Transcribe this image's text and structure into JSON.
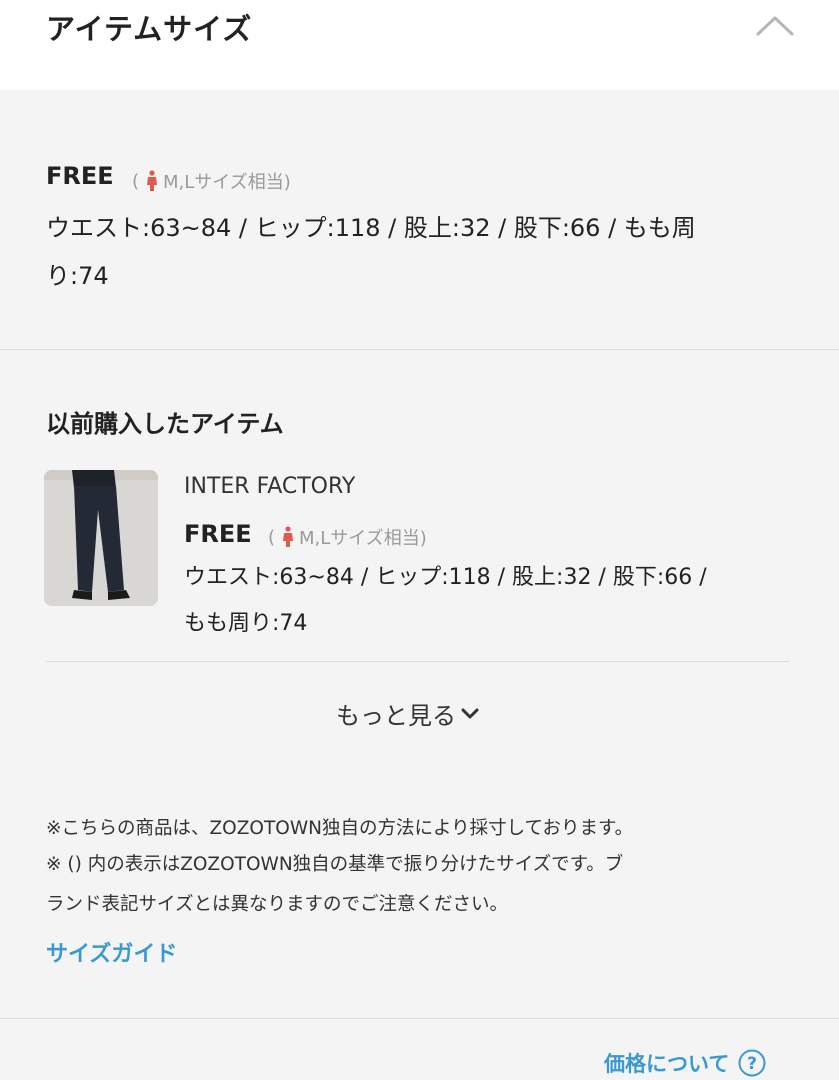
{
  "header": {
    "title": "アイテムサイズ",
    "collapse_icon": "chevron-up-icon"
  },
  "current_size": {
    "label": "FREE",
    "note_open": "(",
    "note_icon": "person-icon",
    "note_text": "M,Lサイズ相当)",
    "measurements_line1": "ウエスト:63~84 / ヒップ:118 / 股上:32 / 股下:66 / もも周",
    "measurements_line2": "り:74"
  },
  "previous": {
    "title": "以前購入したアイテム",
    "item": {
      "brand": "INTER FACTORY",
      "size_label": "FREE",
      "note_open": "(",
      "note_text": "M,Lサイズ相当)",
      "measurements_line1": "ウエスト:63~84 / ヒップ:118 / 股上:32 / 股下:66 /",
      "measurements_line2": "もも周り:74"
    },
    "more_label": "もっと見る"
  },
  "notes": {
    "line1": "※こちらの商品は、ZOZOTOWN独自の方法により採寸しております。",
    "line2": "※ () 内の表示はZOZOTOWN独自の基準で振り分けたサイズです。ブ",
    "line3": "ランド表記サイズとは異なりますのでご注意ください。"
  },
  "size_guide_label": "サイズガイド",
  "price_link_label": "価格について",
  "colors": {
    "link": "#3a9ad0",
    "icon_red": "#e05a4e",
    "background": "#f4f4f4"
  }
}
